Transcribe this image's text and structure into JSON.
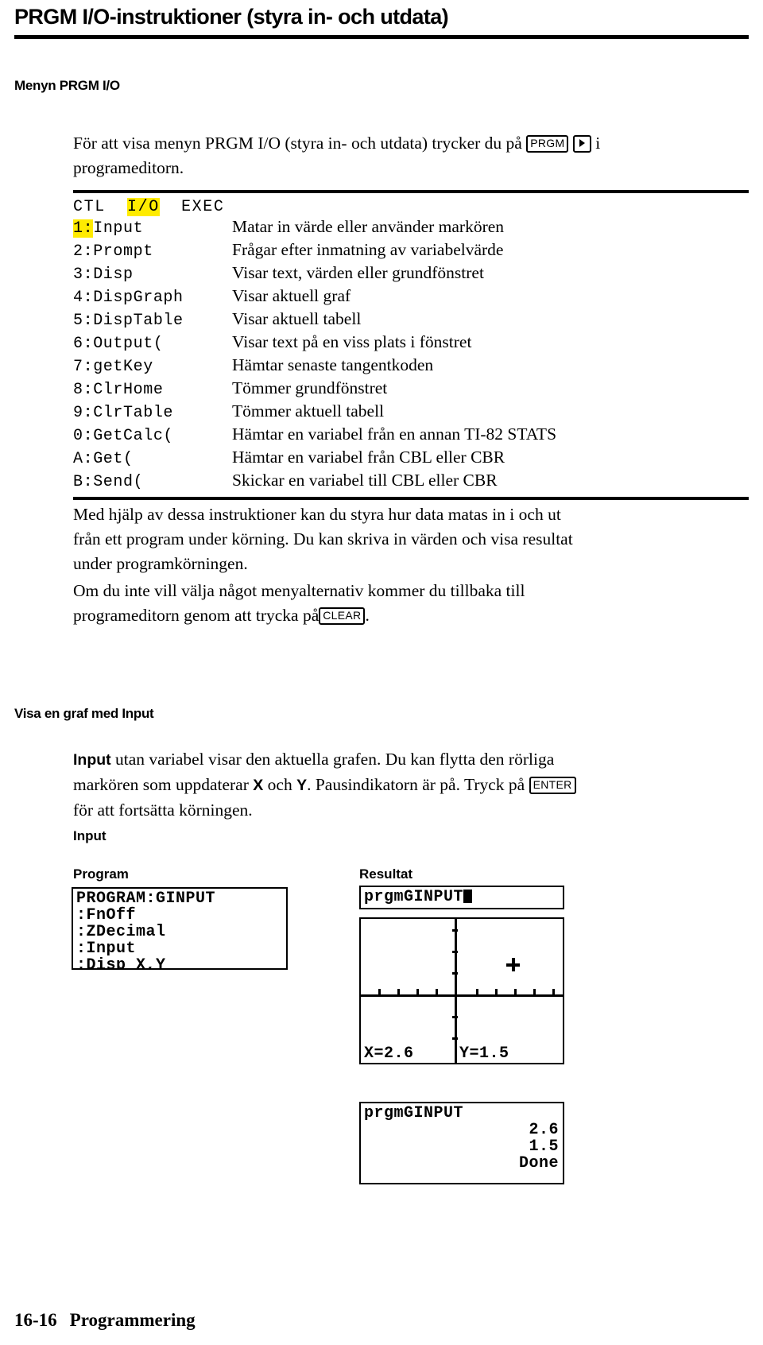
{
  "page": {
    "title": "PRGM I/O-instruktioner (styra in- och utdata)",
    "footer_page": "16-16",
    "footer_section": "Programmering"
  },
  "sections": {
    "menu_heading": "Menyn PRGM I/O",
    "graph_heading": "Visa en graf med Input"
  },
  "intro": {
    "before_key": "För att visa menyn PRGM I/O (styra in- och utdata) trycker du på",
    "key_prgm": "PRGM",
    "key_right_arrow": "right-arrow",
    "after_keys": "i",
    "line2": "programeditorn."
  },
  "menu": {
    "tabs": [
      "CTL",
      "I/O",
      "EXEC"
    ],
    "active_tab": "I/O",
    "selected_row_index": 0,
    "rows": [
      {
        "cmd": "1:Input",
        "num": "1:",
        "name": "Input",
        "desc": "Matar in värde eller använder markören"
      },
      {
        "cmd": "2:Prompt",
        "num": "2:",
        "name": "Prompt",
        "desc": "Frågar efter inmatning av variabelvärde"
      },
      {
        "cmd": "3:Disp",
        "num": "3:",
        "name": "Disp",
        "desc": "Visar text, värden eller grundfönstret"
      },
      {
        "cmd": "4:DispGraph",
        "num": "4:",
        "name": "DispGraph",
        "desc": "Visar aktuell graf"
      },
      {
        "cmd": "5:DispTable",
        "num": "5:",
        "name": "DispTable",
        "desc": "Visar aktuell tabell"
      },
      {
        "cmd": "6:Output(",
        "num": "6:",
        "name": "Output(",
        "desc": "Visar text på en viss plats i fönstret"
      },
      {
        "cmd": "7:getKey",
        "num": "7:",
        "name": "getKey",
        "desc": "Hämtar senaste tangentkoden"
      },
      {
        "cmd": "8:ClrHome",
        "num": "8:",
        "name": "ClrHome",
        "desc": "Tömmer grundfönstret"
      },
      {
        "cmd": "9:ClrTable",
        "num": "9:",
        "name": "ClrTable",
        "desc": "Tömmer aktuell tabell"
      },
      {
        "cmd": "0:GetCalc(",
        "num": "0:",
        "name": "GetCalc(",
        "desc": "Hämtar en variabel från en annan TI-82 STATS"
      },
      {
        "cmd": "A:Get(",
        "num": "A:",
        "name": "Get(",
        "desc": "Hämtar en variabel från CBL eller CBR"
      },
      {
        "cmd": "B:Send(",
        "num": "B:",
        "name": "Send(",
        "desc": "Skickar en variabel till CBL eller CBR"
      }
    ]
  },
  "body": {
    "para1_line1": "Med hjälp av dessa instruktioner kan du styra hur data matas in i och ut",
    "para1_line2": "från ett program under körning. Du kan skriva in värden och visa resultat",
    "para1_line3": "under programkörningen.",
    "para2_line1": "Om du inte vill välja något menyalternativ kommer du tillbaka till",
    "para2_before_key": "programeditorn genom att trycka på",
    "key_clear": "CLEAR",
    "para2_after_key": "."
  },
  "graph_section": {
    "bold_input": "Input",
    "line1_rest": "utan variabel visar den aktuella grafen. Du kan flytta den rörliga",
    "line2_a": "markören som uppdaterar",
    "var_x": "X",
    "line2_b": "och",
    "var_y": "Y",
    "line2_c": ". Pausindikatorn är på. Tryck på",
    "key_enter": "ENTER",
    "line3": "för att fortsätta körningen."
  },
  "example": {
    "title": "Input",
    "program_label": "Program",
    "result_label": "Resultat",
    "program_lines": [
      "PROGRAM:GINPUT",
      ":FnOff",
      ":ZDecimal",
      ":Input",
      ":Disp X,Y"
    ],
    "run_command": "prgmGINPUT",
    "graph_screen": {
      "coord_x": "X=2.6",
      "coord_y": "Y=1.5",
      "marker": "cross-cursor"
    },
    "home_screen": {
      "command": "prgmGINPUT",
      "value_x": "2.6",
      "value_y": "1.5",
      "status": "Done"
    }
  },
  "colors": {
    "highlight": "#ffeb00",
    "ink": "#000000",
    "paper": "#ffffff"
  }
}
